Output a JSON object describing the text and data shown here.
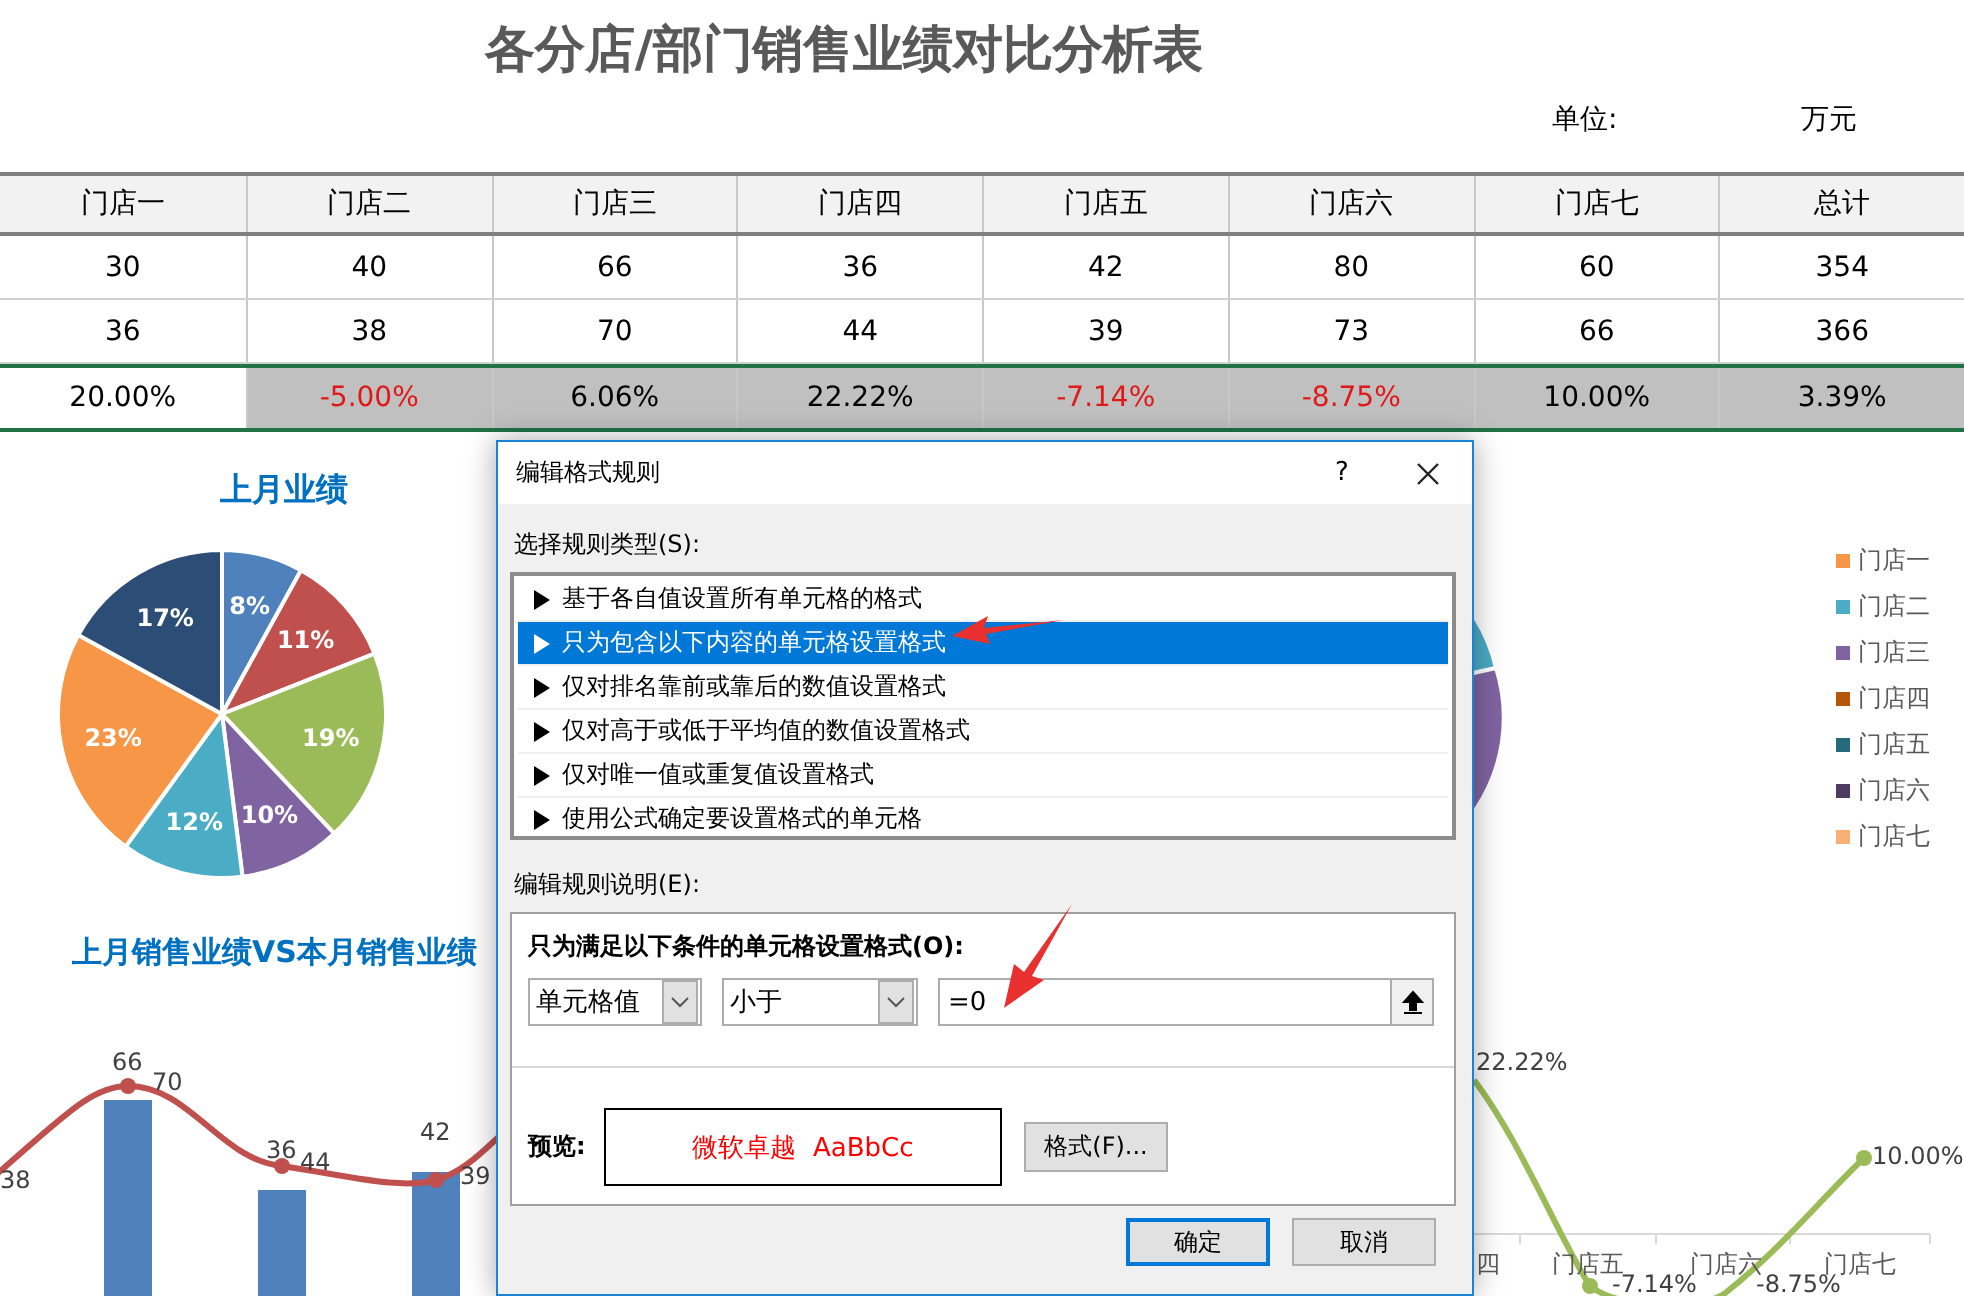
{
  "title": "各分店/部门销售业绩对比分析表",
  "unit": {
    "label": "单位:",
    "value": "万元"
  },
  "table": {
    "columns": [
      "门店一",
      "门店二",
      "门店三",
      "门店四",
      "门店五",
      "门店六",
      "门店七",
      "总计"
    ],
    "rows": [
      {
        "kind": "value",
        "cells": [
          "30",
          "40",
          "66",
          "36",
          "42",
          "80",
          "60",
          "354"
        ]
      },
      {
        "kind": "value",
        "cells": [
          "36",
          "38",
          "70",
          "44",
          "39",
          "73",
          "66",
          "366"
        ]
      },
      {
        "kind": "change",
        "cells": [
          {
            "text": "20.00%",
            "negative": false,
            "shaded": false
          },
          {
            "text": "-5.00%",
            "negative": true,
            "shaded": true
          },
          {
            "text": "6.06%",
            "negative": false,
            "shaded": true
          },
          {
            "text": "22.22%",
            "negative": false,
            "shaded": true
          },
          {
            "text": "-7.14%",
            "negative": true,
            "shaded": true
          },
          {
            "text": "-8.75%",
            "negative": true,
            "shaded": true
          },
          {
            "text": "10.00%",
            "negative": false,
            "shaded": true
          },
          {
            "text": "3.39%",
            "negative": false,
            "shaded": true
          }
        ]
      }
    ]
  },
  "pie_chart": {
    "chart_data": {
      "type": "pie",
      "title": "上月业绩",
      "values": [
        8,
        11,
        19,
        10,
        12,
        23,
        17
      ],
      "value_labels": [
        "8%",
        "11%",
        "19%",
        "10%",
        "12%",
        "23%",
        "17%"
      ]
    }
  },
  "legend": {
    "items": [
      {
        "label": "门店一",
        "color": "#f79646"
      },
      {
        "label": "门店二",
        "color": "#4bacc6"
      },
      {
        "label": "门店三",
        "color": "#8064a2"
      },
      {
        "label": "门店四",
        "color": "#b65708"
      },
      {
        "label": "门店五",
        "color": "#276a7c"
      },
      {
        "label": "门店六",
        "color": "#4d3b62"
      },
      {
        "label": "门店七",
        "color": "#f9b074"
      }
    ]
  },
  "combo_chart": {
    "title": "上月销售业绩VS本月销售业绩",
    "bar_labels": [
      "66",
      "36",
      "42"
    ],
    "line_labels": [
      "38",
      "70",
      "44",
      "39"
    ],
    "change_labels": [
      "22.22%",
      "-7.14%",
      "-8.75%",
      "10.00%"
    ],
    "axis_labels": [
      "四",
      "门店五",
      "门店六",
      "门店七"
    ]
  },
  "dialog": {
    "title": "编辑格式规则",
    "help": "?",
    "rule_type_label": "选择规则类型(S):",
    "rule_types": [
      {
        "label": "基于各自值设置所有单元格的格式",
        "selected": false
      },
      {
        "label": "只为包含以下内容的单元格设置格式",
        "selected": true
      },
      {
        "label": "仅对排名靠前或靠后的数值设置格式",
        "selected": false
      },
      {
        "label": "仅对高于或低于平均值的数值设置格式",
        "selected": false
      },
      {
        "label": "仅对唯一值或重复值设置格式",
        "selected": false
      },
      {
        "label": "使用公式确定要设置格式的单元格",
        "selected": false
      }
    ],
    "description_label": "编辑规则说明(E):",
    "condition_label": "只为满足以下条件的单元格设置格式(O):",
    "condition": {
      "operand": "单元格值",
      "operator": "小于",
      "value": "=0"
    },
    "preview_label": "预览:",
    "preview_text": "微软卓越  AaBbCc",
    "format_button": "格式(F)...",
    "buttons": [
      {
        "label": "确定",
        "default": true
      },
      {
        "label": "取消",
        "default": false
      }
    ]
  }
}
